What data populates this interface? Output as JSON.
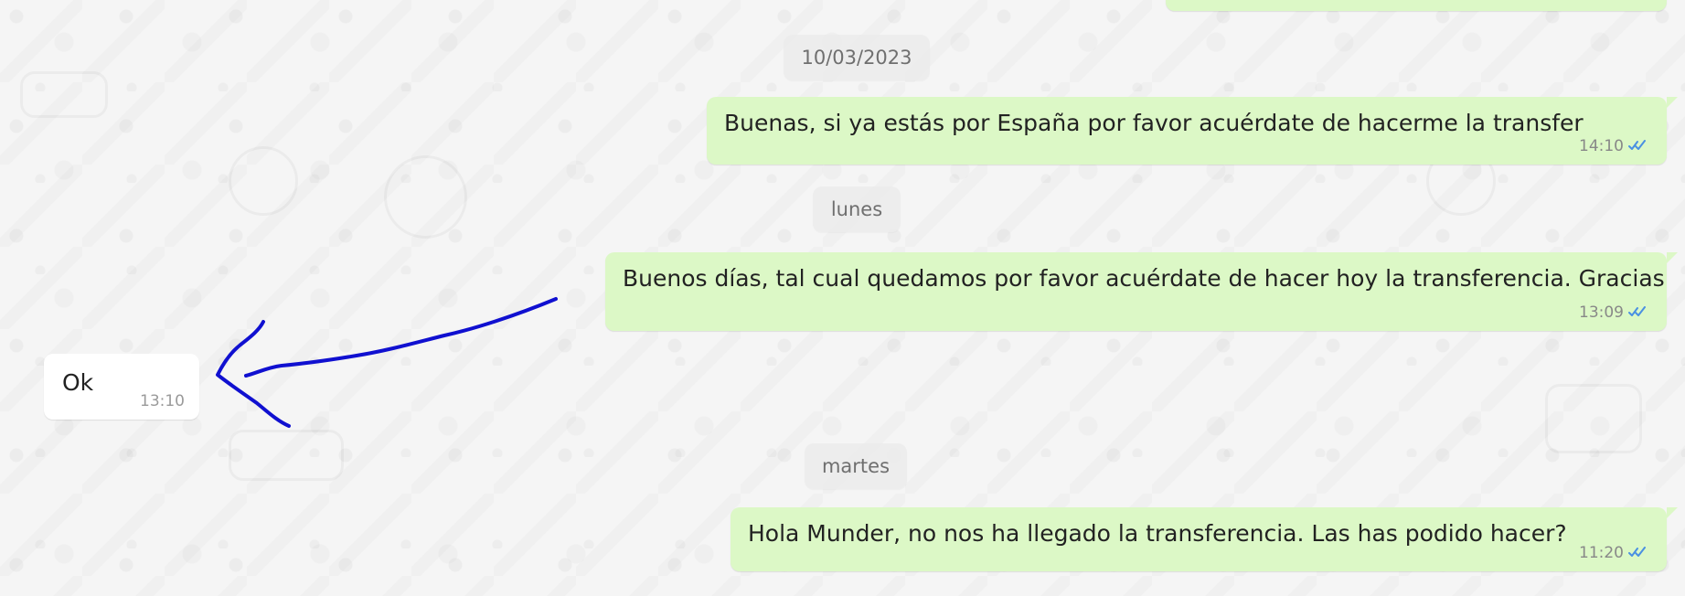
{
  "chat": {
    "date_separators": {
      "first": "10/03/2023",
      "second": "lunes",
      "third": "martes"
    },
    "messages": [
      {
        "direction": "outgoing",
        "text": "Buenas, si ya estás por España por favor acuérdate de hacerme la transfer",
        "time": "14:10",
        "status": "read"
      },
      {
        "direction": "outgoing",
        "text": "Buenos días, tal cual quedamos por favor acuérdate de hacer hoy la transferencia. Gracias",
        "time": "13:09",
        "status": "read"
      },
      {
        "direction": "incoming",
        "text": "Ok",
        "time": "13:10"
      },
      {
        "direction": "outgoing",
        "text": "Hola Munder, no nos ha llegado la transferencia. Las has podido hacer?",
        "time": "11:20",
        "status": "read"
      }
    ]
  },
  "colors": {
    "outgoing_bubble": "#dcf8c6",
    "incoming_bubble": "#ffffff",
    "read_ticks": "#4a90e2",
    "annotation_arrow": "#1010d0"
  },
  "icons": {
    "read_status": "double-check-icon",
    "annotation": "hand-drawn-arrow-icon"
  }
}
